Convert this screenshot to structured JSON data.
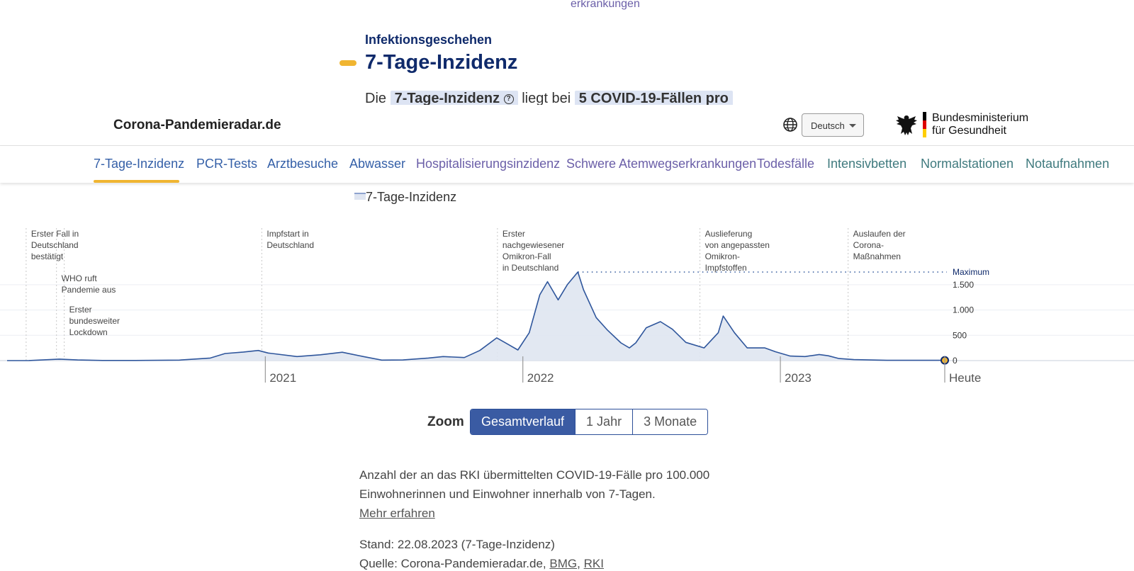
{
  "top": {
    "cut_text": "erkrankungen",
    "section_kicker": "Infektionsgeschehen",
    "section_title": "7-Tage-Inzidenz",
    "intro_prefix": "Die",
    "intro_term": "7-Tage-Inzidenz",
    "intro_middle": "liegt bei",
    "intro_value": "5 COVID-19-Fällen pro"
  },
  "header": {
    "brand": "Corona-Pandemieradar.de",
    "language_selected": "Deutsch",
    "ministry_line1": "Bundesministerium",
    "ministry_line2": "für Gesundheit",
    "icons": [
      "globe-icon",
      "chevron-down-icon",
      "federal-eagle-logo"
    ]
  },
  "tabs": [
    {
      "label": "7-Tage-Inzidenz",
      "active": true
    },
    {
      "label": "PCR-Tests"
    },
    {
      "label": "Arztbesuche"
    },
    {
      "label": "Abwasser"
    },
    {
      "label": "Hospitalisierungsinzidenz"
    },
    {
      "label": "Schwere Atemwegserkrankungen"
    },
    {
      "label": "Todesfälle"
    },
    {
      "label": "Intensivbetten"
    },
    {
      "label": "Normalstationen"
    },
    {
      "label": "Notaufnahmen"
    }
  ],
  "colors": {
    "navy": "#0f2a6b",
    "accent_yellow": "#f0b531",
    "line": "#2f569c",
    "area": "#dfe5f1",
    "tab_purple": "#6b5fa8",
    "tab_teal": "#3f7a7e",
    "tab_blue": "#3560a8"
  },
  "chart_data": {
    "type": "area",
    "series": [
      {
        "name": "7-Tage-Inzidenz",
        "points": [
          [
            "2020-01-01",
            0
          ],
          [
            "2020-02-01",
            2
          ],
          [
            "2020-03-15",
            30
          ],
          [
            "2020-04-10",
            12
          ],
          [
            "2020-05-15",
            3
          ],
          [
            "2020-07-01",
            3
          ],
          [
            "2020-09-01",
            10
          ],
          [
            "2020-10-15",
            50
          ],
          [
            "2020-11-05",
            140
          ],
          [
            "2020-12-01",
            170
          ],
          [
            "2020-12-22",
            200
          ],
          [
            "2021-01-05",
            150
          ],
          [
            "2021-02-15",
            80
          ],
          [
            "2021-03-20",
            115
          ],
          [
            "2021-04-20",
            165
          ],
          [
            "2021-05-20",
            80
          ],
          [
            "2021-06-15",
            10
          ],
          [
            "2021-07-15",
            12
          ],
          [
            "2021-08-20",
            50
          ],
          [
            "2021-09-10",
            80
          ],
          [
            "2021-10-10",
            60
          ],
          [
            "2021-11-01",
            200
          ],
          [
            "2021-11-25",
            450
          ],
          [
            "2021-12-10",
            330
          ],
          [
            "2021-12-25",
            210
          ],
          [
            "2022-01-10",
            550
          ],
          [
            "2022-01-25",
            1300
          ],
          [
            "2022-02-05",
            1560
          ],
          [
            "2022-02-20",
            1200
          ],
          [
            "2022-03-05",
            1500
          ],
          [
            "2022-03-20",
            1750
          ],
          [
            "2022-03-28",
            1400
          ],
          [
            "2022-04-15",
            850
          ],
          [
            "2022-05-01",
            600
          ],
          [
            "2022-05-20",
            350
          ],
          [
            "2022-06-01",
            250
          ],
          [
            "2022-06-10",
            350
          ],
          [
            "2022-06-25",
            650
          ],
          [
            "2022-07-15",
            770
          ],
          [
            "2022-08-01",
            620
          ],
          [
            "2022-08-20",
            360
          ],
          [
            "2022-09-15",
            250
          ],
          [
            "2022-10-05",
            550
          ],
          [
            "2022-10-12",
            880
          ],
          [
            "2022-10-28",
            550
          ],
          [
            "2022-11-15",
            250
          ],
          [
            "2022-12-10",
            250
          ],
          [
            "2022-12-25",
            175
          ],
          [
            "2023-01-15",
            90
          ],
          [
            "2023-02-05",
            80
          ],
          [
            "2023-02-25",
            120
          ],
          [
            "2023-03-10",
            95
          ],
          [
            "2023-03-25",
            40
          ],
          [
            "2023-04-15",
            20
          ],
          [
            "2023-06-01",
            6
          ],
          [
            "2023-08-22",
            5
          ]
        ]
      }
    ],
    "xlim": [
      "2020-01-01",
      "2023-08-22"
    ],
    "ylim": [
      0,
      1750
    ],
    "y_ticks": [
      "0",
      "500",
      "1.000",
      "1.500"
    ],
    "y_max_label": "Maximum",
    "x_ticks": [
      {
        "date": "2021-01-01",
        "label": "2021"
      },
      {
        "date": "2022-01-01",
        "label": "2022"
      },
      {
        "date": "2023-01-01",
        "label": "2023"
      },
      {
        "date": "2023-08-22",
        "label": "Heute"
      }
    ],
    "annotations": [
      {
        "date": "2020-01-28",
        "lines": [
          "Erster Fall in",
          "Deutschland",
          "bestätigt"
        ],
        "row": 0
      },
      {
        "date": "2020-03-11",
        "lines": [
          "WHO ruft",
          "Pandemie aus"
        ],
        "row": 1
      },
      {
        "date": "2020-03-22",
        "lines": [
          "Erster",
          "bundesweiter",
          "Lockdown"
        ],
        "row": 2
      },
      {
        "date": "2020-12-27",
        "lines": [
          "Impfstart in",
          "Deutschland"
        ],
        "row": 0
      },
      {
        "date": "2021-11-26",
        "lines": [
          "Erster",
          "nachgewiesener",
          "Omikron-Fall",
          "in Deutschland"
        ],
        "row": 0
      },
      {
        "date": "2022-09-09",
        "lines": [
          "Auslieferung",
          "von angepassten",
          "Omikron-",
          "Impfstoffen"
        ],
        "row": 0
      },
      {
        "date": "2023-04-07",
        "lines": [
          "Auslaufen der",
          "Corona-",
          "Maßnahmen"
        ],
        "row": 0
      }
    ],
    "grid": true,
    "legend_position": "top-left"
  },
  "zoom": {
    "label": "Zoom",
    "options": [
      "Gesamtverlauf",
      "1 Jahr",
      "3 Monate"
    ],
    "selected": "Gesamtverlauf"
  },
  "description": {
    "text": "Anzahl der an das RKI übermittelten COVID-19-Fälle pro 100.000 Einwohnerinnen und Einwohner innerhalb von 7-Tagen.",
    "link": "Mehr erfahren"
  },
  "meta": {
    "stand": "Stand: 22.08.2023 (7-Tage-Inzidenz)",
    "source_prefix": "Quelle: Corona-Pandemieradar.de,",
    "source_bmg": "BMG",
    "source_sep": ",",
    "source_rki": "RKI"
  }
}
